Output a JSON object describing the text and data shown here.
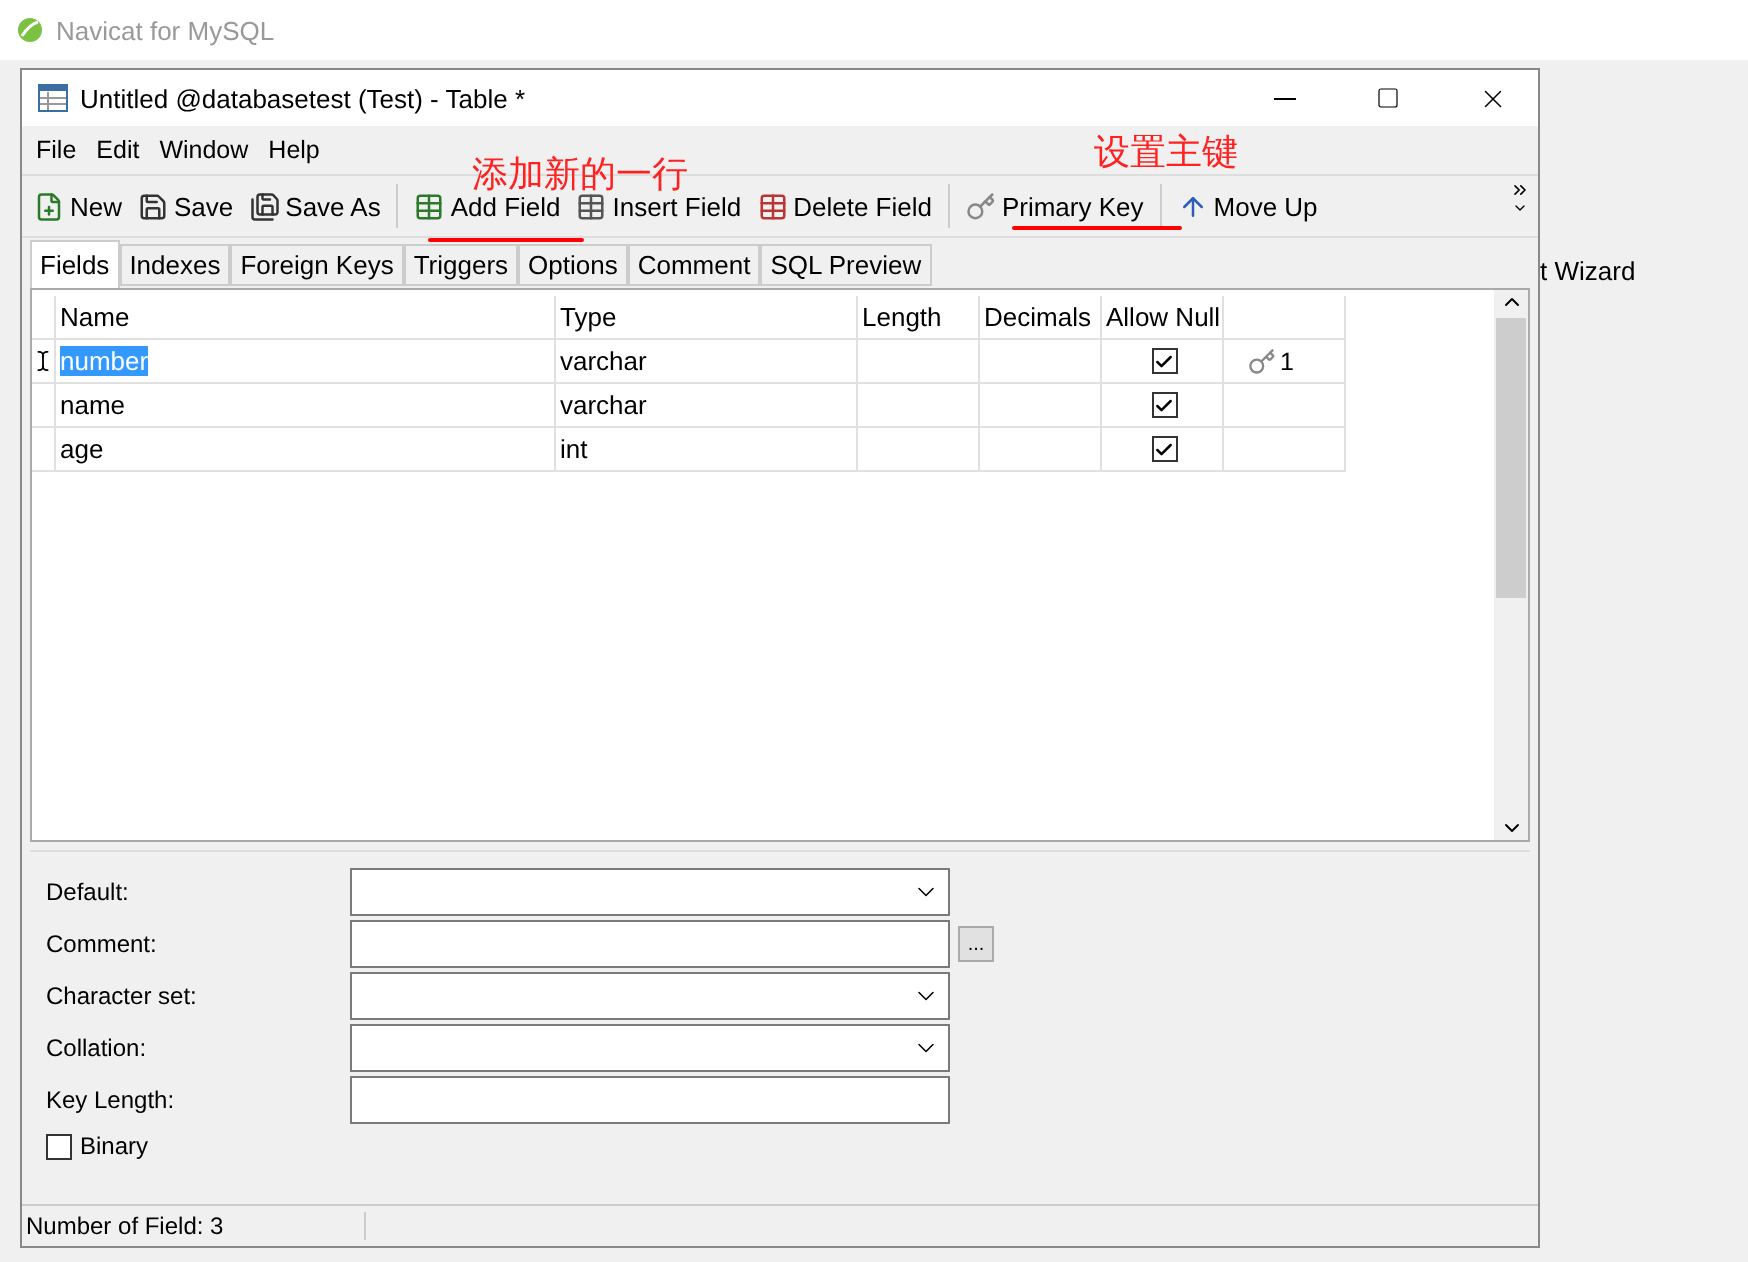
{
  "app": {
    "title": "Navicat for MySQL",
    "background_text": "t Wizard"
  },
  "window": {
    "title": "Untitled @databasetest (Test) - Table *"
  },
  "menu": [
    "File",
    "Edit",
    "Window",
    "Help"
  ],
  "toolbar_groups": [
    [
      "New",
      "Save",
      "Save As"
    ],
    [
      "Add Field",
      "Insert Field",
      "Delete Field"
    ],
    [
      "Primary Key"
    ],
    [
      "Move Up"
    ]
  ],
  "annotations": [
    {
      "text": "添加新的一行"
    },
    {
      "text": "设置主键"
    }
  ],
  "tabs": [
    {
      "label": "Fields",
      "selected": true
    },
    {
      "label": "Indexes",
      "selected": false
    },
    {
      "label": "Foreign Keys",
      "selected": false
    },
    {
      "label": "Triggers",
      "selected": false
    },
    {
      "label": "Options",
      "selected": false
    },
    {
      "label": "Comment",
      "selected": false
    },
    {
      "label": "SQL Preview",
      "selected": false
    }
  ],
  "columns": [
    "Name",
    "Type",
    "Length",
    "Decimals",
    "Allow Null"
  ],
  "rows": [
    {
      "name": "number",
      "type": "varchar",
      "allow_null": true,
      "key": "1",
      "selected": true
    },
    {
      "name": "name",
      "type": "varchar",
      "allow_null": true,
      "selected": false
    },
    {
      "name": "age",
      "type": "int",
      "allow_null": true,
      "selected": false
    }
  ],
  "properties": [
    {
      "label": "Default:",
      "kind": "dropdown"
    },
    {
      "label": "Comment:",
      "kind": "text_button",
      "button": "..."
    },
    {
      "label": "Character set:",
      "kind": "dropdown"
    },
    {
      "label": "Collation:",
      "kind": "dropdown"
    },
    {
      "label": "Key Length:",
      "kind": "text"
    }
  ],
  "binary": {
    "label": "Binary",
    "checked": false
  },
  "status": "Number of Field: 3"
}
